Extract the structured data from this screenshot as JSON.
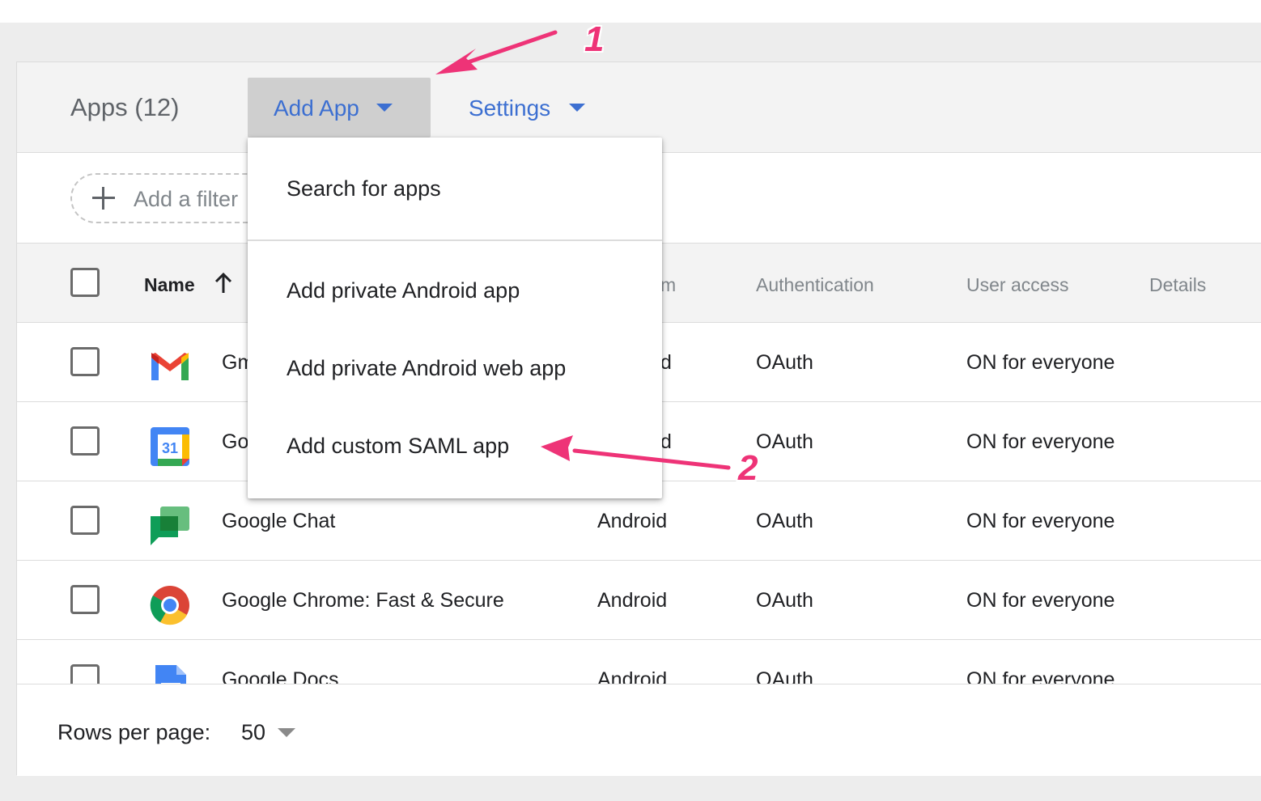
{
  "toolbar": {
    "title": "Apps (12)",
    "add_app_label": "Add App",
    "settings_label": "Settings"
  },
  "filter": {
    "placeholder": "Add a filter"
  },
  "table": {
    "columns": {
      "name": "Name",
      "platform_partial": "m",
      "authentication": "Authentication",
      "user_access": "User access",
      "details": "Details"
    },
    "rows": [
      {
        "icon": "gmail-icon",
        "name": "Gm",
        "platform": "d",
        "auth": "OAuth",
        "access": "ON for everyone"
      },
      {
        "icon": "google-calendar-icon",
        "calendar_day": "31",
        "name": "Go",
        "platform": "d",
        "auth": "OAuth",
        "access": "ON for everyone"
      },
      {
        "icon": "google-chat-icon",
        "name": "Google Chat",
        "platform": "Android",
        "auth": "OAuth",
        "access": "ON for everyone"
      },
      {
        "icon": "google-chrome-icon",
        "name": "Google Chrome: Fast & Secure",
        "platform": "Android",
        "auth": "OAuth",
        "access": "ON for everyone"
      },
      {
        "icon": "google-docs-icon",
        "name": "Google Docs",
        "platform": "Android",
        "auth": "OAuth",
        "access": "ON for everyone"
      }
    ]
  },
  "menu": {
    "items": [
      {
        "label": "Search for apps"
      },
      {
        "label": "Add private Android app"
      },
      {
        "label": "Add private Android web app"
      },
      {
        "label": "Add custom SAML app"
      }
    ]
  },
  "pagination": {
    "rows_per_page_label": "Rows per page:",
    "rows_per_page_value": "50"
  },
  "annotations": {
    "step1": "1",
    "step2": "2",
    "color": "#ee3377"
  }
}
